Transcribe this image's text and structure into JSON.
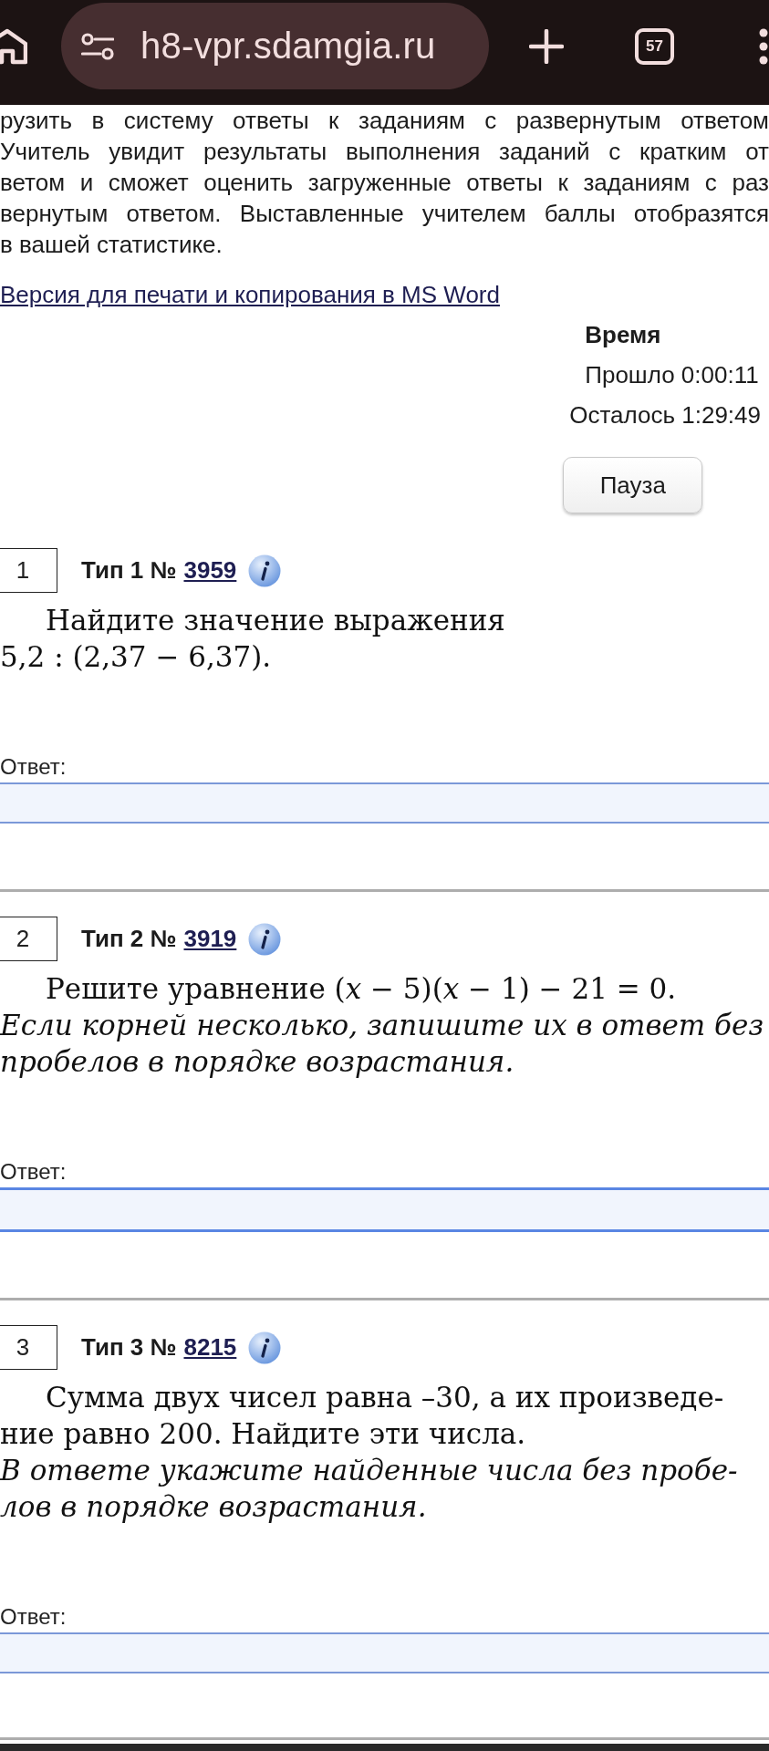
{
  "browser_bar": {
    "url": "h8-vpr.sdamgia.ru",
    "tab_count": "57"
  },
  "intro": {
    "lines": [
      "рузить в систему ответы к заданиям с развернутым ответом",
      "Учитель увидит результаты выполнения заданий с кратким от",
      "ветом и сможет оценить загруженные ответы к заданиям с раз",
      "вернутым ответом. Выставленные учителем баллы отобразятся",
      "в вашей статистике."
    ]
  },
  "print_link": "Версия для печати и копирования в MS Word",
  "timer": {
    "title": "Время",
    "elapsed": "Прошло 0:00:11",
    "remaining": "Осталось 1:29:49",
    "pause_button": "Пауза"
  },
  "tasks": [
    {
      "number": "1",
      "type_label": "Тип 1 №",
      "task_id": "3959",
      "paragraphs": [
        {
          "kind": "statement",
          "lines": [
            "Найдите значение выражения",
            "5,2 : (2,37 − 6,37)."
          ]
        }
      ],
      "answer_label": "Ответ:",
      "answer_field": {
        "focused": false
      }
    },
    {
      "number": "2",
      "type_label": "Тип 2 №",
      "task_id": "3919",
      "paragraphs": [
        {
          "kind": "statement",
          "lines": [
            "Решите уравнение  (*x* − 5)(*x* − 1) − 21 = 0."
          ]
        },
        {
          "kind": "instruction",
          "lines": [
            "Если корней несколько, запишите их в ответ без",
            "пробелов в порядке возрастания."
          ]
        }
      ],
      "answer_label": "Ответ:",
      "answer_field": {
        "focused": true
      }
    },
    {
      "number": "3",
      "type_label": "Тип 3 №",
      "task_id": "8215",
      "paragraphs": [
        {
          "kind": "statement",
          "lines": [
            "Сумма двух чисел равна –30, а их произведе-",
            "ние равно 200. Найдите эти числа."
          ]
        },
        {
          "kind": "instruction",
          "lines": [
            "В ответе укажите найденные числа без пробе-",
            "лов в порядке возрастания."
          ]
        }
      ],
      "answer_label": "Ответ:",
      "answer_field": {
        "focused": false
      }
    }
  ]
}
